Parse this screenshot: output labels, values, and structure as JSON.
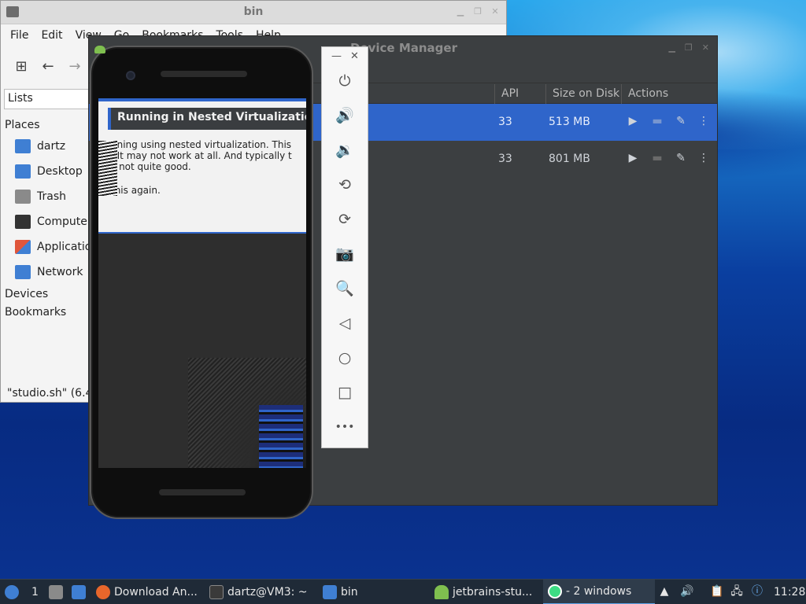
{
  "file_manager": {
    "title": "bin",
    "menu": [
      "File",
      "Edit",
      "View",
      "Go",
      "Bookmarks",
      "Tools",
      "Help"
    ],
    "location_mode": "Lists",
    "places_header": "Places",
    "places": [
      {
        "label": "dartz",
        "icon": "home-folder-icon",
        "color": "#3f7fd3"
      },
      {
        "label": "Desktop",
        "icon": "desktop-icon",
        "color": "#3f7fd3"
      },
      {
        "label": "Trash",
        "icon": "trash-icon",
        "color": "#8a8a8a"
      },
      {
        "label": "Computer",
        "icon": "computer-icon",
        "color": "#333333"
      },
      {
        "label": "Applications",
        "icon": "applications-icon",
        "color": "#e0563b"
      },
      {
        "label": "Network",
        "icon": "network-icon",
        "color": "#3f7fd3"
      }
    ],
    "devices_header": "Devices",
    "bookmarks_header": "Bookmarks",
    "status": "\"studio.sh\" (6.4"
  },
  "device_manager": {
    "title": "Device Manager",
    "columns": {
      "api": "API",
      "size": "Size on Disk",
      "actions": "Actions"
    },
    "devices": [
      {
        "api": "33",
        "size": "513 MB",
        "selected": true
      },
      {
        "api": "33",
        "size": "801 MB",
        "selected": false
      }
    ],
    "selection_color": "#2f65ca"
  },
  "emulator": {
    "dialog_title": "Running in Nested Virtualization",
    "dialog_lines": [
      "nning using nested virtualization. This",
      ". It may not work at all. And typically t",
      "s not quite good.",
      "this again."
    ],
    "toolbar": [
      {
        "name": "power-icon",
        "glyph": "⏻"
      },
      {
        "name": "volume-up-icon",
        "glyph": "🔊"
      },
      {
        "name": "volume-down-icon",
        "glyph": "🔉"
      },
      {
        "name": "rotate-left-icon",
        "glyph": "⟲"
      },
      {
        "name": "rotate-right-icon",
        "glyph": "⟳"
      },
      {
        "name": "camera-icon",
        "glyph": "📷"
      },
      {
        "name": "zoom-icon",
        "glyph": "🔍"
      },
      {
        "name": "back-icon",
        "glyph": "◁"
      },
      {
        "name": "home-icon",
        "glyph": "○"
      },
      {
        "name": "overview-icon",
        "glyph": "□"
      },
      {
        "name": "more-icon",
        "glyph": "•••"
      }
    ]
  },
  "taskbar": {
    "workspace": "1",
    "items": [
      {
        "label": "Download An...",
        "icon": "firefox-icon",
        "color": "#e8662b"
      },
      {
        "label": "dartz@VM3: ~",
        "icon": "terminal-icon",
        "color": "#3a3a3a"
      },
      {
        "label": "bin",
        "icon": "folder-icon",
        "color": "#3f7fd3"
      },
      {
        "label": "jetbrains-stu...",
        "icon": "android-icon",
        "color": "#7fbf4f"
      },
      {
        "label": "- 2 windows",
        "icon": "android-studio-icon",
        "color": "#3ddc84"
      }
    ],
    "clock": "11:28"
  }
}
